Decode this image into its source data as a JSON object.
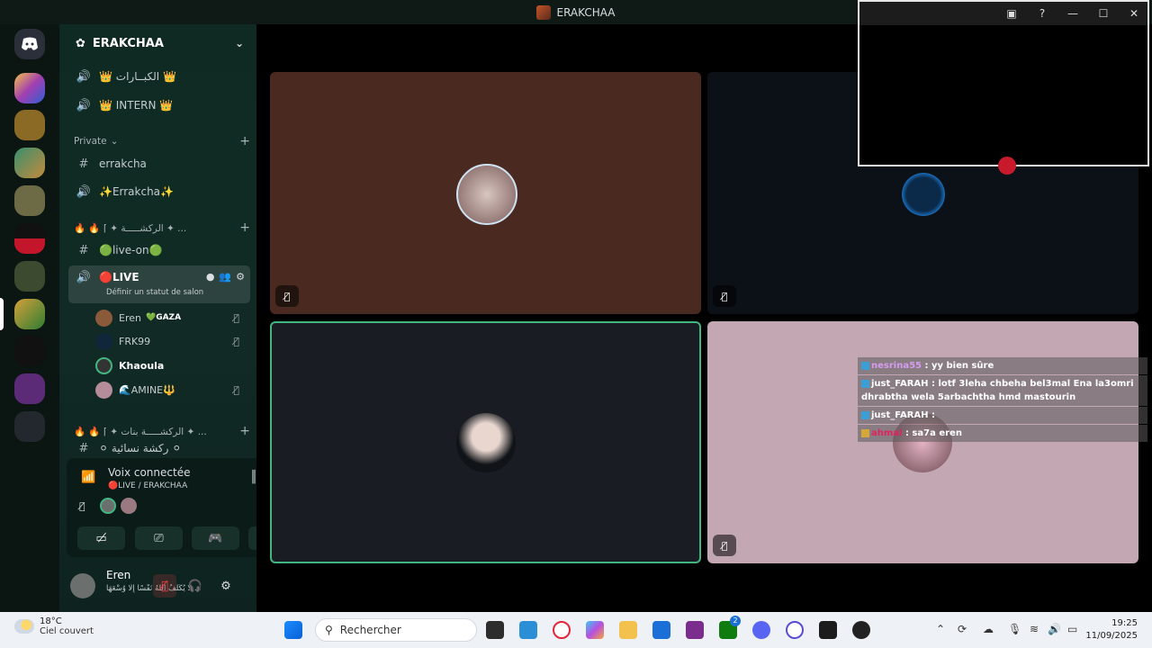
{
  "window": {
    "title": "ERAKCHAA"
  },
  "server": {
    "name": "ERAKCHAA"
  },
  "channels": {
    "top": [
      {
        "name": "👑 الكبــارات 👑"
      },
      {
        "name": "👑 INTERN 👑"
      }
    ],
    "category_private": "Private",
    "private": [
      {
        "name": "errakcha"
      },
      {
        "name": "✨Errakcha✨"
      }
    ],
    "category_2": "🔥 🔥 ⌈ ✦ الركشـــــة ✦ ...",
    "cat2_items": [
      {
        "name": "🟢live-on🟢"
      }
    ],
    "live": {
      "name": "🔴LIVE",
      "status_hint": "Définir un statut de salon"
    },
    "members": [
      {
        "name": "Eren",
        "tag": "💚GAZA",
        "muted": true
      },
      {
        "name": "FRK99",
        "tag": "",
        "muted": true
      },
      {
        "name": "Khaoula",
        "tag": "",
        "muted": false
      },
      {
        "name": "🌊AMINE🔱",
        "tag": "",
        "muted": true
      }
    ],
    "category_3": "🔥 🔥 ⌈ ✦ الركشـــــة بنات ✦ ...",
    "cat3_item": "⚪ ركشة نسائية ⚪"
  },
  "voice": {
    "title": "Voix connectée",
    "subtitle": "🔴LIVE / ERAKCHAA"
  },
  "user": {
    "name": "Eren",
    "status": "لَا يُكَلِّفُ اللَّهُ نَفْسًا إِلَّا وُسْعَهَا ."
  },
  "chat": [
    {
      "user": "nesrina55",
      "text": ": yy bien sûre",
      "color": "#d59cf0"
    },
    {
      "user": "just_FARAH",
      "text": ": lotf 3leha chbeha bel3mal Ena la3omri dhrabtha wela 5arbachtha hmd mastourin",
      "color": "#ffffff"
    },
    {
      "user": "just_FARAH",
      "text": ":",
      "color": "#ffffff"
    },
    {
      "user": "ahmal",
      "text": ": sa7a eren",
      "color": "#e0245e"
    }
  ],
  "taskbar": {
    "temp": "18°C",
    "condition": "Ciel couvert",
    "search_placeholder": "Rechercher",
    "time": "19:25",
    "date": "11/09/2025",
    "xbox_badge": "2"
  },
  "colors": {
    "tile1": "#4a2a20",
    "tile2": "#0c1118",
    "tile3": "#1a1c24",
    "tile4": "#c3a7b3",
    "speaking": "#43b581"
  }
}
